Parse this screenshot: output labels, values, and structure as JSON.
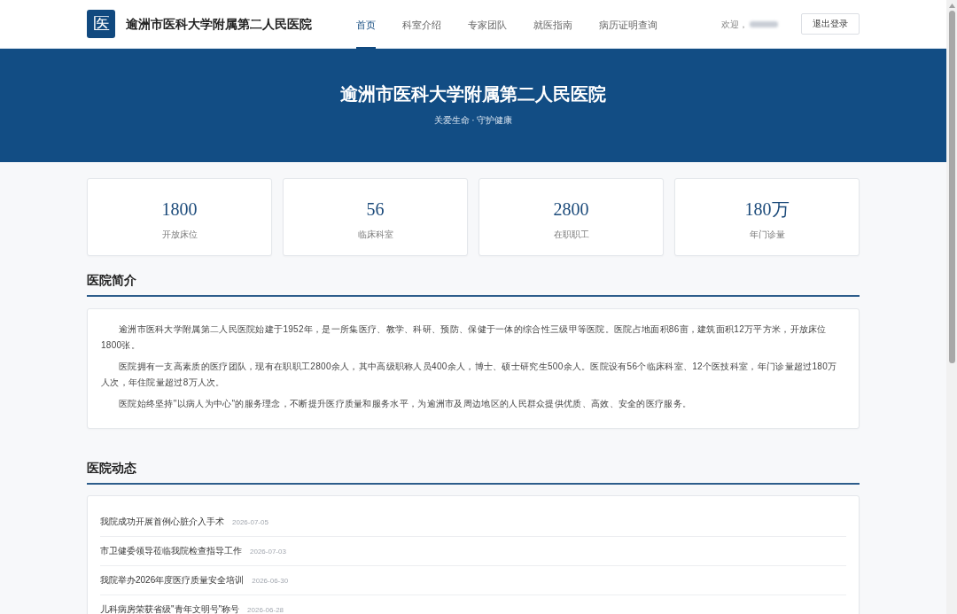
{
  "header": {
    "logo": "医",
    "title": "逾洲市医科大学附属第二人民医院",
    "nav": [
      {
        "label": "首页",
        "selected": true
      },
      {
        "label": "科室介绍",
        "selected": false
      },
      {
        "label": "专家团队",
        "selected": false
      },
      {
        "label": "就医指南",
        "selected": false
      },
      {
        "label": "病历证明查询",
        "selected": false
      }
    ],
    "welcome": "欢迎，",
    "logout_button": "退出登录"
  },
  "banner": {
    "title": "逾洲市医科大学附属第二人民医院",
    "subtitle": "关爱生命 · 守护健康"
  },
  "stats": [
    {
      "value": "1800",
      "label": "开放床位"
    },
    {
      "value": "56",
      "label": "临床科室"
    },
    {
      "value": "2800",
      "label": "在职职工"
    },
    {
      "value": "180万",
      "label": "年门诊量"
    }
  ],
  "intro": {
    "heading": "医院简介",
    "paragraphs": [
      "逾洲市医科大学附属第二人民医院始建于1952年，是一所集医疗、教学、科研、预防、保健于一体的综合性三级甲等医院。医院占地面积86亩，建筑面积12万平方米，开放床位1800张。",
      "医院拥有一支高素质的医疗团队，现有在职职工2800余人，其中高级职称人员400余人，博士、硕士研究生500余人。医院设有56个临床科室、12个医技科室，年门诊量超过180万人次，年住院量超过8万人次。",
      "医院始终坚持\"以病人为中心\"的服务理念，不断提升医疗质量和服务水平，为逾洲市及周边地区的人民群众提供优质、高效、安全的医疗服务。"
    ]
  },
  "news": {
    "heading": "医院动态",
    "items": [
      {
        "title": "我院成功开展首例心脏介入手术",
        "date": "2026-07-05"
      },
      {
        "title": "市卫健委领导莅临我院检查指导工作",
        "date": "2026-07-03"
      },
      {
        "title": "我院举办2026年度医疗质量安全培训",
        "date": "2026-06-30"
      },
      {
        "title": "儿科病房荣获省级\"青年文明号\"称号",
        "date": "2026-06-28"
      }
    ]
  }
}
